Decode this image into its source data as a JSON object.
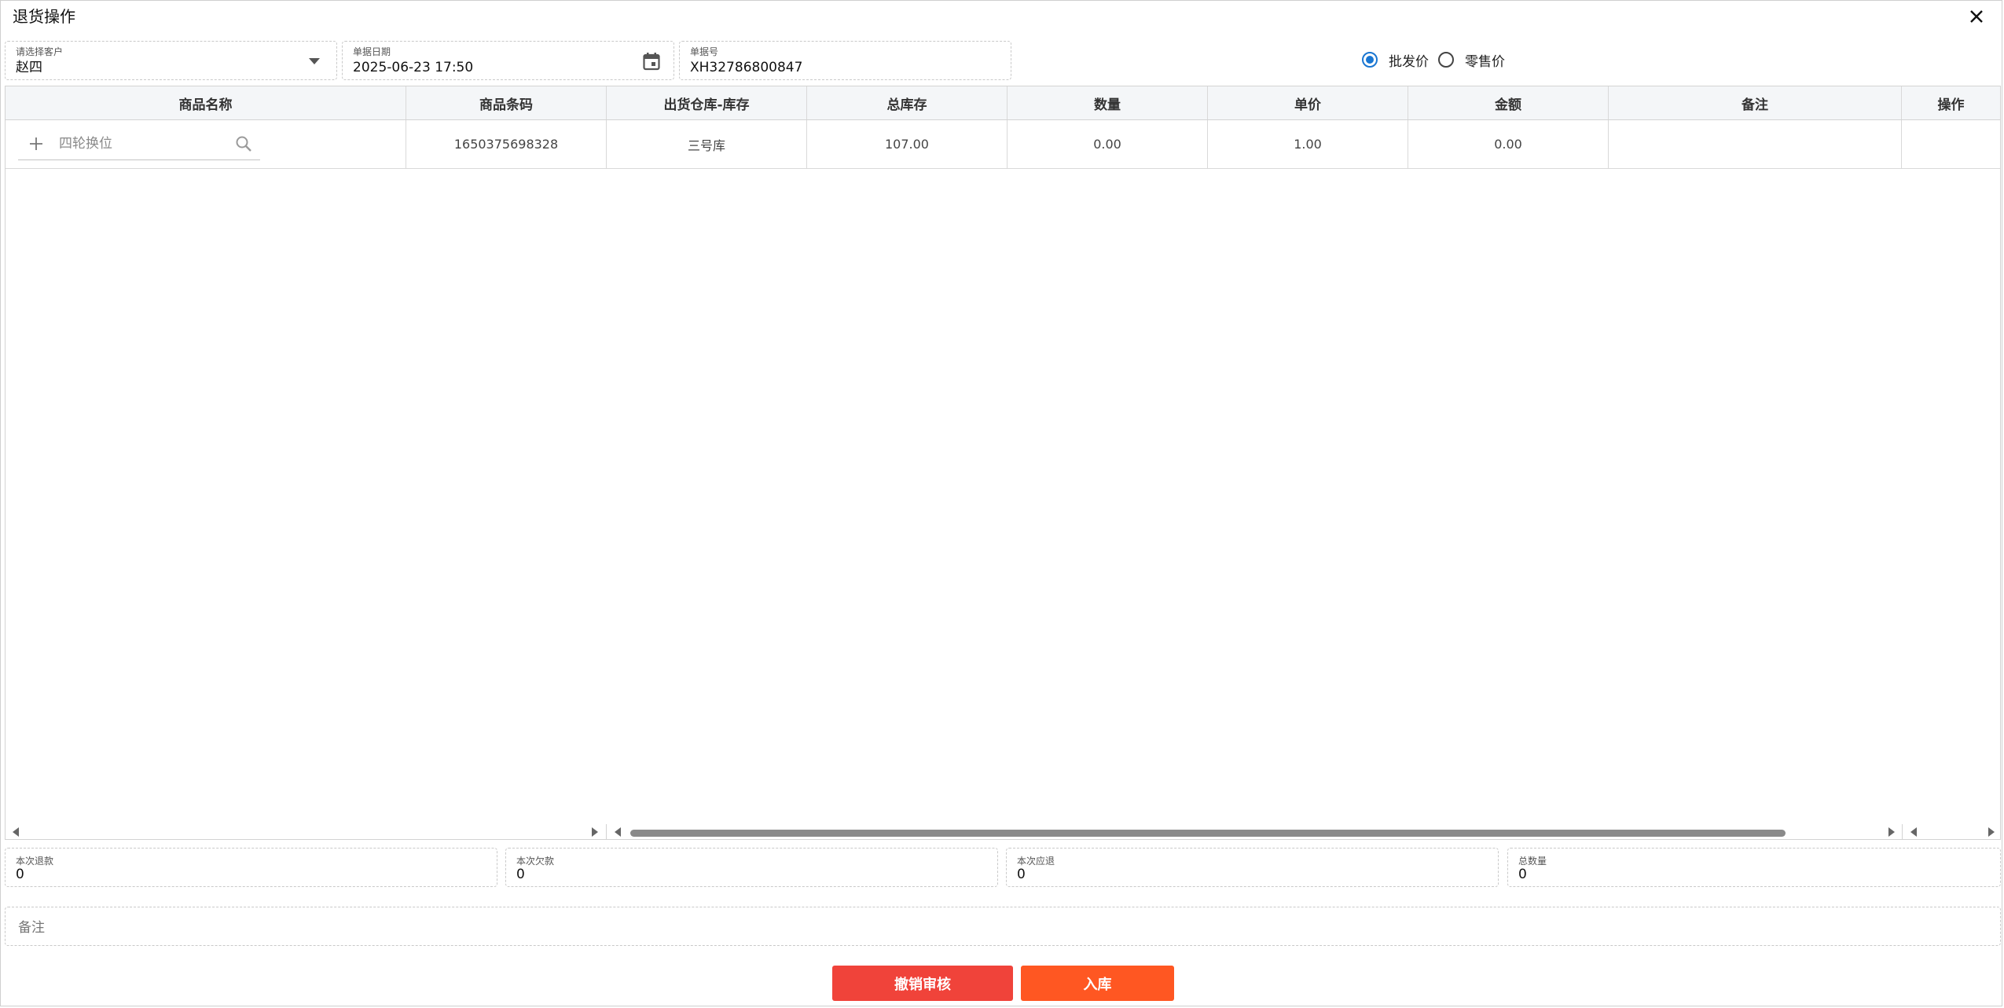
{
  "dialog": {
    "title": "退货操作"
  },
  "form": {
    "customer": {
      "label": "请选择客户",
      "value": "赵四"
    },
    "date": {
      "label": "单据日期",
      "value": "2025-06-23 17:50"
    },
    "doc_no": {
      "label": "单据号",
      "value": "XH32786800847"
    }
  },
  "price_type": {
    "options": [
      {
        "label": "批发价",
        "selected": true
      },
      {
        "label": "零售价",
        "selected": false
      }
    ]
  },
  "table": {
    "columns": [
      "商品名称",
      "商品条码",
      "出货仓库-库存",
      "总库存",
      "数量",
      "单价",
      "金额",
      "备注",
      "操作"
    ],
    "rows": [
      {
        "name_placeholder": "四轮换位",
        "barcode": "1650375698328",
        "warehouse": "三号库",
        "total_stock": "107.00",
        "quantity": "0.00",
        "unit_price": "1.00",
        "amount": "0.00",
        "remark": "",
        "action": ""
      }
    ]
  },
  "summary": [
    {
      "label": "本次退款",
      "value": "0"
    },
    {
      "label": "本次欠款",
      "value": "0"
    },
    {
      "label": "本次应退",
      "value": "0"
    },
    {
      "label": "总数量",
      "value": "0"
    }
  ],
  "remark": {
    "placeholder": "备注"
  },
  "buttons": {
    "cancel_review": {
      "label": "撤销审核",
      "color": "#f0433a"
    },
    "stock_in": {
      "label": "入库",
      "color": "#ff5722"
    }
  },
  "colors": {
    "accent": "#1976d2",
    "header_bg": "#f4f6f8"
  }
}
